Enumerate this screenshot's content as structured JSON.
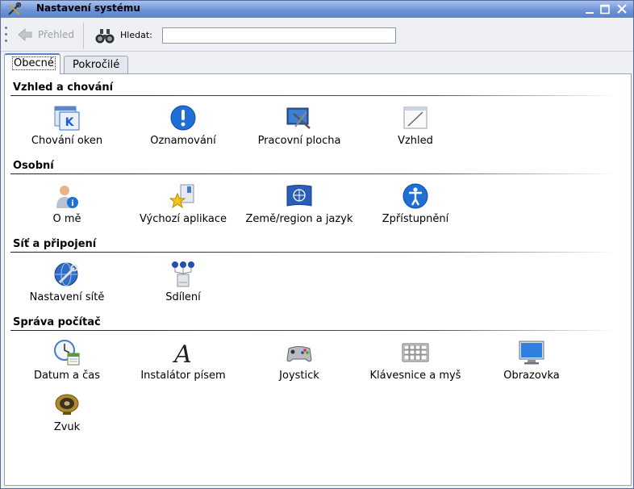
{
  "window": {
    "title": "Nastavení systému"
  },
  "toolbar": {
    "back_label": "Přehled",
    "find_label": "Hledat:",
    "search_value": ""
  },
  "tabs": [
    {
      "label": "Obecné",
      "active": true
    },
    {
      "label": "Pokročilé",
      "active": false
    }
  ],
  "sections": [
    {
      "title": "Vzhled a chování",
      "items": [
        {
          "label": "Chování oken",
          "icon": "window-behavior-icon"
        },
        {
          "label": "Oznamování",
          "icon": "notification-icon"
        },
        {
          "label": "Pracovní plocha",
          "icon": "desktop-icon"
        },
        {
          "label": "Vzhled",
          "icon": "appearance-icon"
        }
      ]
    },
    {
      "title": "Osobní",
      "items": [
        {
          "label": "O mě",
          "icon": "user-info-icon"
        },
        {
          "label": "Výchozí aplikace",
          "icon": "default-apps-icon"
        },
        {
          "label": "Země/region a jazyk",
          "icon": "un-flag-icon"
        },
        {
          "label": "Zpřístupnění",
          "icon": "accessibility-icon"
        }
      ]
    },
    {
      "title": "Síť a připojení",
      "items": [
        {
          "label": "Nastavení sítě",
          "icon": "network-globe-icon"
        },
        {
          "label": "Sdílení",
          "icon": "sharing-icon"
        }
      ]
    },
    {
      "title": "Správa počítač",
      "items": [
        {
          "label": "Datum a čas",
          "icon": "clock-calendar-icon"
        },
        {
          "label": "Instalátor písem",
          "icon": "font-icon"
        },
        {
          "label": "Joystick",
          "icon": "gamepad-icon"
        },
        {
          "label": "Klávesnice a myš",
          "icon": "keyboard-icon"
        },
        {
          "label": "Obrazovka",
          "icon": "monitor-icon"
        },
        {
          "label": "Zvuk",
          "icon": "speaker-icon"
        }
      ]
    }
  ],
  "colors": {
    "titlebar": "#6f93d8",
    "accent": "#1f5fcf"
  }
}
